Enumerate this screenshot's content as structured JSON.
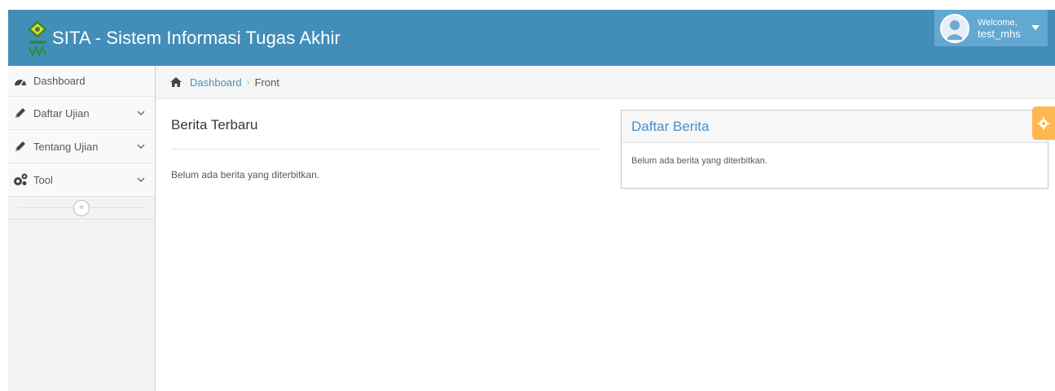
{
  "navbar": {
    "title": "SITA - Sistem Informasi Tugas Akhir",
    "welcome_label": "Welcome,",
    "username": "test_mhs",
    "color": "#438eb9"
  },
  "sidebar": {
    "items": [
      {
        "label": "Dashboard",
        "icon": "tachometer-icon"
      },
      {
        "label": "Daftar Ujian",
        "icon": "pencil-icon"
      },
      {
        "label": "Tentang Ujian",
        "icon": "pencil-icon"
      },
      {
        "label": "Tool",
        "icon": "cogs-icon"
      }
    ],
    "collapse_symbol": "«"
  },
  "breadcrumb": {
    "home_label": "Dashboard",
    "separator": "›",
    "current": "Front"
  },
  "main": {
    "section_title": "Berita Terbaru",
    "empty_text": "Belum ada berita yang diterbitkan."
  },
  "widget": {
    "title": "Daftar Berita",
    "body_text": "Belum ada berita yang diterbitkan."
  },
  "colors": {
    "accent": "#438eb9",
    "link": "#4c8fbd",
    "settings": "#ffb752"
  }
}
